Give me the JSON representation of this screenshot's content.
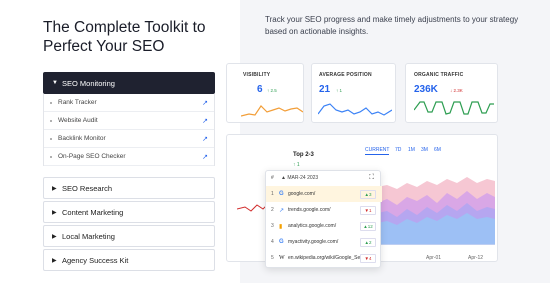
{
  "heading": "The Complete Toolkit to Perfect Your SEO",
  "intro": "Track your SEO progress and make timely adjustments to your strategy based on actionable insights.",
  "accordion": [
    {
      "label": "SEO Monitoring",
      "expanded": true,
      "items": [
        "Rank Tracker",
        "Website Audit",
        "Backlink Monitor",
        "On-Page SEO Checker"
      ]
    },
    {
      "label": "SEO Research"
    },
    {
      "label": "Content Marketing"
    },
    {
      "label": "Local Marketing"
    },
    {
      "label": "Agency Success Kit"
    }
  ],
  "metrics": [
    {
      "title": "VISIBILITY",
      "value": "6",
      "delta": "2.5",
      "dir": "up",
      "color": "#2563eb"
    },
    {
      "title": "AVERAGE POSITION",
      "value": "21",
      "delta": "1",
      "dir": "up",
      "color": "#2563eb"
    },
    {
      "title": "ORGANIC TRAFFIC",
      "value": "236K",
      "delta": "2.3K",
      "dir": "down",
      "color": "#2e9e52"
    }
  ],
  "chart": {
    "group_label": "Top 2-3",
    "group_value": "1",
    "tabs": [
      "CURRENT",
      "7D",
      "1M",
      "3M",
      "6M"
    ],
    "x_ticks": [
      "Apr-01",
      "Apr-12"
    ]
  },
  "popup": {
    "date": "MAR-24 2023",
    "hash": "#",
    "rows": [
      {
        "num": "1",
        "icon": "google-icon",
        "url": "google.com/",
        "delta": "3",
        "dir": "up"
      },
      {
        "num": "2",
        "icon": "trends-icon",
        "url": "trends.google.com/",
        "delta": "1",
        "dir": "down"
      },
      {
        "num": "3",
        "icon": "analytics-icon",
        "url": "analytics.google.com/",
        "delta": "12",
        "dir": "up"
      },
      {
        "num": "4",
        "icon": "google-icon",
        "url": "myactivity.google.com/",
        "delta": "2",
        "dir": "up"
      },
      {
        "num": "5",
        "icon": "wikipedia-icon",
        "url": "en.wikipedia.org/wiki/Google_Se...",
        "delta": "4",
        "dir": "down"
      }
    ]
  }
}
